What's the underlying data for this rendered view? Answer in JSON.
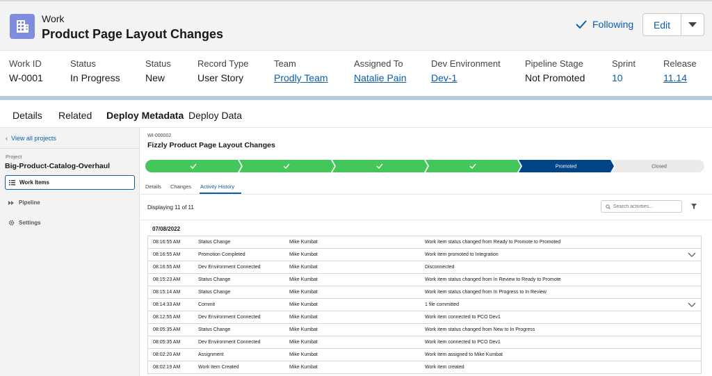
{
  "header": {
    "object_label": "Work",
    "title": "Product Page Layout Changes",
    "following_label": "Following",
    "edit_label": "Edit",
    "icon": "building-icon",
    "accent": "#7f8de1"
  },
  "fields": [
    {
      "label": "Work ID",
      "value": "W-0001",
      "link": false
    },
    {
      "label": "Status",
      "value": "In Progress",
      "link": false
    },
    {
      "label": "Status",
      "value": "New",
      "link": false
    },
    {
      "label": "Record Type",
      "value": "User Story",
      "link": false
    },
    {
      "label": "Team",
      "value": "Prodly Team",
      "link": true
    },
    {
      "label": "Assigned To",
      "value": "Natalie Pain",
      "link": true
    },
    {
      "label": "Dev Environment",
      "value": "Dev-1",
      "link": true
    },
    {
      "label": "Pipeline Stage",
      "value": "Not Promoted",
      "link": false
    },
    {
      "label": "Sprint",
      "value": "10",
      "link": true
    },
    {
      "label": "Release",
      "value": "11.14",
      "link": true
    }
  ],
  "tabs": [
    "Details",
    "Related",
    "Deploy Metadata",
    "Deploy Data"
  ],
  "active_tab": "Deploy Metadata",
  "sidebar": {
    "back_label": "View all projects",
    "project_label": "Project",
    "project_name": "Big-Product-Catalog-Overhaul",
    "items": [
      {
        "label": "Work Items",
        "icon": "list-icon"
      },
      {
        "label": "Pipeline",
        "icon": "pipeline-icon"
      },
      {
        "label": "Settings",
        "icon": "gear-icon"
      }
    ]
  },
  "work_item": {
    "id": "WI-000002",
    "title": "Fizzly Product Page Layout Changes"
  },
  "path_stages": [
    {
      "label": "",
      "state": "complete"
    },
    {
      "label": "",
      "state": "complete"
    },
    {
      "label": "",
      "state": "complete"
    },
    {
      "label": "",
      "state": "complete"
    },
    {
      "label": "Promoted",
      "state": "current"
    },
    {
      "label": "Closed",
      "state": "upcoming"
    }
  ],
  "subtabs": [
    "Details",
    "Changes",
    "Activity History"
  ],
  "active_subtab": "Activity History",
  "activity": {
    "displaying": "Displaying 11 of 11",
    "search_placeholder": "Search activities...",
    "date": "07/08/2022",
    "rows": [
      {
        "time": "08:16:55 AM",
        "event": "Status Change",
        "user": "Mike Kumbat",
        "desc": "Work item status changed from Ready to Promote to Promoted",
        "expand": false
      },
      {
        "time": "08:16:55 AM",
        "event": "Promotion Completed",
        "user": "Mike Kumbat",
        "desc": "Work item promoted to Integration",
        "expand": true
      },
      {
        "time": "08:16:55 AM",
        "event": "Dev Environment Connected",
        "user": "Mike Kumbat",
        "desc": "Disconnected",
        "expand": false
      },
      {
        "time": "08:15:23 AM",
        "event": "Status Change",
        "user": "Mike Kumbat",
        "desc": "Work item status changed from In Review to Ready to Promote",
        "expand": false
      },
      {
        "time": "08:15:14 AM",
        "event": "Status Change",
        "user": "Mike Kumbat",
        "desc": "Work item status changed from In Progress to In Review",
        "expand": false
      },
      {
        "time": "08:14:33 AM",
        "event": "Commit",
        "user": "Mike Kumbat",
        "desc": "1 file committed",
        "expand": true
      },
      {
        "time": "08:12:55 AM",
        "event": "Dev Environment Connected",
        "user": "Mike Kumbat",
        "desc": "Work item connected to PCO Dev1",
        "expand": false
      },
      {
        "time": "08:05:35 AM",
        "event": "Status Change",
        "user": "Mike Kumbat",
        "desc": "Work item status changed from New to In Progress",
        "expand": false
      },
      {
        "time": "08:05:35 AM",
        "event": "Dev Environment Connected",
        "user": "Mike Kumbat",
        "desc": "Work item connected to PCO Dev1",
        "expand": false
      },
      {
        "time": "08:02:20 AM",
        "event": "Assignment",
        "user": "Mike Kumbat",
        "desc": "Work item assigned to Mike Kumbat",
        "expand": false
      },
      {
        "time": "08:02:19 AM",
        "event": "Work Item Created",
        "user": "Mike Kumbat",
        "desc": "Work item created",
        "expand": false
      }
    ]
  },
  "colors": {
    "complete": "#45c65a",
    "current": "#014486",
    "upcoming": "#ecebea",
    "link": "#0b5cab"
  }
}
